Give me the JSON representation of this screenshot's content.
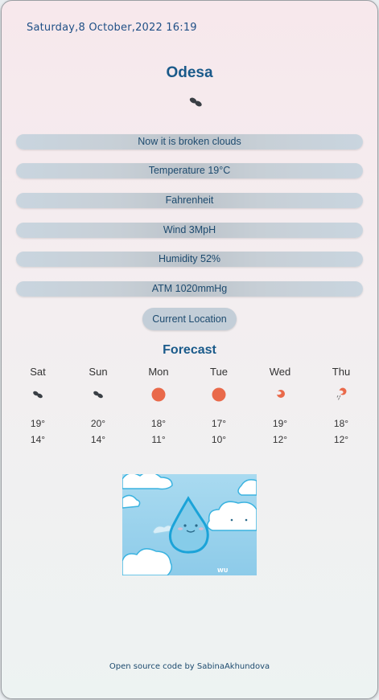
{
  "header": {
    "datetime": "Saturday,8 October,2022 16:19"
  },
  "current": {
    "city": "Odesa",
    "icon": "broken-clouds-icon",
    "description": "Now it is broken clouds",
    "temperature": "Temperature 19°C",
    "unit_toggle": "Fahrenheit",
    "wind": "Wind 3MpH",
    "humidity": "Humidity 52%",
    "atm": "ATM 1020mmHg"
  },
  "location_button": "Current Location",
  "forecast": {
    "title": "Forecast",
    "days": [
      {
        "name": "Sat",
        "icon": "broken-clouds-icon",
        "max": "19°",
        "min": "14°"
      },
      {
        "name": "Sun",
        "icon": "broken-clouds-icon",
        "max": "20°",
        "min": "14°"
      },
      {
        "name": "Mon",
        "icon": "sun-icon",
        "max": "18°",
        "min": "11°"
      },
      {
        "name": "Tue",
        "icon": "sun-icon",
        "max": "17°",
        "min": "10°"
      },
      {
        "name": "Wed",
        "icon": "few-clouds-icon",
        "max": "19°",
        "min": "12°"
      },
      {
        "name": "Thu",
        "icon": "rain-icon",
        "max": "18°",
        "min": "12°"
      }
    ]
  },
  "footer": {
    "text": "Open source code by SabinaAkhundova"
  },
  "colors": {
    "accent": "#1a5a8a",
    "sun": "#e9694a",
    "cloud": "#3a3f45"
  }
}
